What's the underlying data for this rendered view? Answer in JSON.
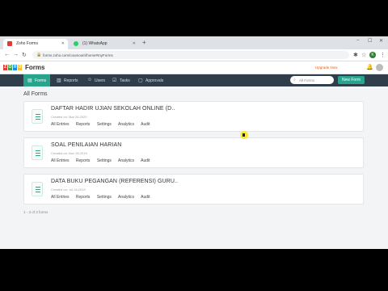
{
  "browser": {
    "tabs": [
      {
        "label": "Zoho Forms",
        "active": true
      },
      {
        "label": "(1) WhatsApp",
        "active": false
      }
    ],
    "new_tab": "+",
    "url": "forms.zoho.com/coumoutri/home#myForms",
    "window_controls": [
      "–",
      "☐",
      "✕"
    ]
  },
  "app": {
    "brand": "Forms",
    "logo_letters": [
      "Z",
      "O",
      "H",
      "O"
    ],
    "upgrade_link": "Upgrade Now"
  },
  "nav": {
    "items": [
      {
        "label": "Forms",
        "icon": "forms-icon",
        "active": true
      },
      {
        "label": "Reports",
        "icon": "reports-icon",
        "active": false
      },
      {
        "label": "Users",
        "icon": "users-icon",
        "active": false
      },
      {
        "label": "Tasks",
        "icon": "tasks-icon",
        "active": false
      },
      {
        "label": "Approvals",
        "icon": "approvals-icon",
        "active": false
      }
    ],
    "search_placeholder": "All Forms",
    "new_form_label": "New Form"
  },
  "heading": "All Forms",
  "forms": [
    {
      "title": "DAFTAR HADIR UJIAN SEKOLAH ONLINE (D..",
      "created": "Created on: Mar 26,2020",
      "actions": [
        "All Entries",
        "Reports",
        "Settings",
        "Analytics",
        "Audit"
      ]
    },
    {
      "title": "SOAL PENILAIAN HARIAN",
      "created": "Created on: Nov 26,2019",
      "actions": [
        "All Entries",
        "Reports",
        "Settings",
        "Analytics",
        "Audit"
      ]
    },
    {
      "title": "DATA BUKU PEGANGAN (REFERENSI) GURU..",
      "created": "Created on: Jul 16,2019",
      "actions": [
        "All Entries",
        "Reports",
        "Settings",
        "Analytics",
        "Audit"
      ]
    }
  ],
  "pagination": "1 - 3 of 3 forms",
  "colors": {
    "accent": "#28a48c",
    "navbar": "#2f3e4a",
    "upgrade": "#e8621a"
  }
}
